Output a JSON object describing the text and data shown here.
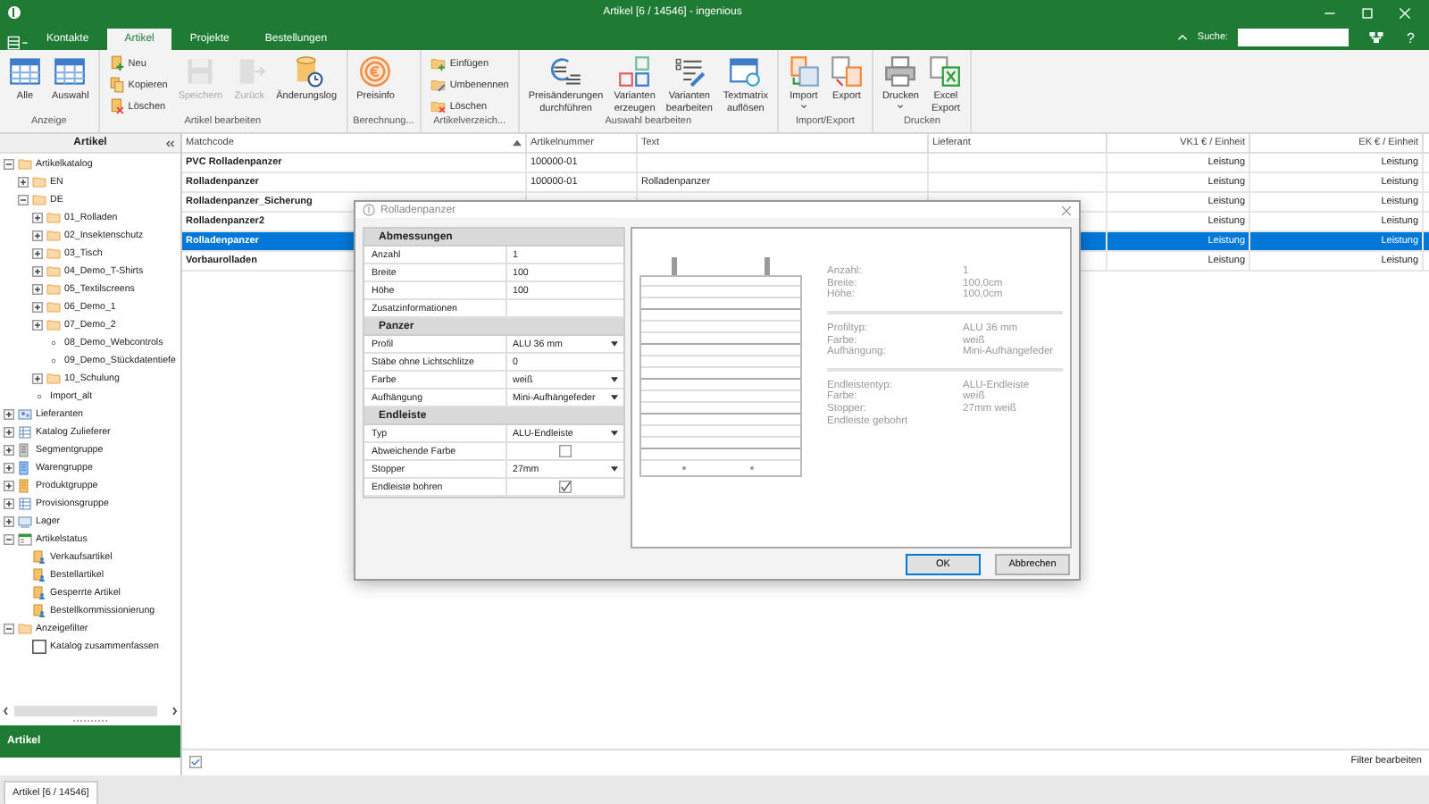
{
  "window": {
    "title": "Artikel [6 / 14546] - ingenious"
  },
  "tabs": [
    {
      "label": "Kontakte",
      "selected": false
    },
    {
      "label": "Artikel",
      "selected": true
    },
    {
      "label": "Projekte",
      "selected": false
    },
    {
      "label": "Bestellungen",
      "selected": false
    }
  ],
  "search": {
    "label": "Suche:",
    "help": "?"
  },
  "ribbon": {
    "groups": [
      {
        "label": "Anzeige",
        "items": [
          {
            "kind": "large",
            "label": "Alle",
            "disabled": false
          },
          {
            "kind": "large",
            "label": "Auswahl",
            "disabled": false
          }
        ]
      },
      {
        "label": "Artikel bearbeiten",
        "items": [
          {
            "kind": "stack",
            "items": [
              {
                "label": "Neu",
                "disabled": false
              },
              {
                "label": "Kopieren",
                "disabled": false
              },
              {
                "label": "Löschen",
                "disabled": false
              }
            ]
          },
          {
            "kind": "large",
            "label": "Speichern",
            "disabled": true
          },
          {
            "kind": "large",
            "label": "Zurück",
            "disabled": true
          },
          {
            "kind": "large",
            "label": "Änderungslog",
            "disabled": false
          }
        ]
      },
      {
        "label": "Berechnung...",
        "items": [
          {
            "kind": "large",
            "label": "Preisinfo",
            "disabled": false
          }
        ]
      },
      {
        "label": "Artikelverzeich...",
        "items": [
          {
            "kind": "stack",
            "items": [
              {
                "label": "Einfügen",
                "disabled": false
              },
              {
                "label": "Umbenennen",
                "disabled": false
              },
              {
                "label": "Löschen",
                "disabled": false
              }
            ]
          }
        ]
      },
      {
        "label": "Auswahl bearbeiten",
        "items": [
          {
            "kind": "large",
            "label": "Preisänderungen durchführen",
            "disabled": false
          },
          {
            "kind": "large",
            "label": "Varianten erzeugen",
            "disabled": false
          },
          {
            "kind": "large",
            "label": "Varianten bearbeiten",
            "disabled": false
          },
          {
            "kind": "large",
            "label": "Textmatrix auflösen",
            "disabled": false
          }
        ]
      },
      {
        "label": "Import/Export",
        "items": [
          {
            "kind": "large",
            "label": "Import",
            "disabled": false,
            "dropdown": true
          },
          {
            "kind": "large",
            "label": "Export",
            "disabled": false,
            "dropdown": false
          }
        ]
      },
      {
        "label": "Drucken",
        "items": [
          {
            "kind": "large",
            "label": "Drucken",
            "disabled": false,
            "dropdown": true
          },
          {
            "kind": "large",
            "label": "Excel Export",
            "disabled": false,
            "dropdown": false
          }
        ]
      }
    ]
  },
  "sidebar": {
    "title": "Artikel",
    "footer": "Artikel",
    "tree": [
      {
        "label": "Artikelkatalog",
        "kind": "folder",
        "expanded": true,
        "children": [
          {
            "label": "EN",
            "kind": "folder",
            "expanded": false
          },
          {
            "label": "DE",
            "kind": "folder",
            "expanded": true,
            "children": [
              {
                "label": "01_Rolladen",
                "kind": "folder",
                "expanded": false
              },
              {
                "label": "02_Insektenschutz",
                "kind": "folder",
                "expanded": false
              },
              {
                "label": "03_Tisch",
                "kind": "folder",
                "expanded": false
              },
              {
                "label": "04_Demo_T-Shirts",
                "kind": "folder",
                "expanded": false
              },
              {
                "label": "05_Textilscreens",
                "kind": "folder",
                "expanded": false
              },
              {
                "label": "06_Demo_1",
                "kind": "folder",
                "expanded": false
              },
              {
                "label": "07_Demo_2",
                "kind": "folder",
                "expanded": false
              },
              {
                "label": "08_Demo_Webcontrols",
                "kind": "leaf"
              },
              {
                "label": "09_Demo_Stückdatentiefe",
                "kind": "leaf"
              },
              {
                "label": "10_Schulung",
                "kind": "folder",
                "expanded": false
              }
            ]
          },
          {
            "label": "Import_alt",
            "kind": "leaf"
          }
        ]
      },
      {
        "label": "Lieferanten",
        "kind": "category",
        "expanded": false
      },
      {
        "label": "Katalog Zulieferer",
        "kind": "category",
        "expanded": false
      },
      {
        "label": "Segmentgruppe",
        "kind": "category",
        "expanded": false
      },
      {
        "label": "Warengruppe",
        "kind": "category",
        "expanded": false
      },
      {
        "label": "Produktgruppe",
        "kind": "category",
        "expanded": false
      },
      {
        "label": "Provisionsgruppe",
        "kind": "category",
        "expanded": false
      },
      {
        "label": "Lager",
        "kind": "category",
        "expanded": false
      },
      {
        "label": "Artikelstatus",
        "kind": "category",
        "expanded": true,
        "children": [
          {
            "label": "Verkaufsartikel",
            "kind": "entry"
          },
          {
            "label": "Bestellartikel",
            "kind": "entry"
          },
          {
            "label": "Gesperrte Artikel",
            "kind": "entry"
          },
          {
            "label": "Bestellkommissionierung",
            "kind": "entry"
          }
        ]
      },
      {
        "label": "Anzeigefilter",
        "kind": "folder",
        "expanded": true,
        "children": [
          {
            "label": "Katalog zusammenfassen",
            "kind": "checkbox",
            "checked": false
          }
        ]
      }
    ]
  },
  "table": {
    "columns": [
      "Matchcode",
      "Artikelnummer",
      "Text",
      "Lieferant",
      "VK1 € / Einheit",
      "EK € / Einheit"
    ],
    "rows": [
      {
        "cells": [
          "PVC Rolladenpanzer",
          "100000-01",
          "",
          "",
          "Leistung",
          "Leistung"
        ],
        "selected": false
      },
      {
        "cells": [
          "Rolladenpanzer",
          "100000-01",
          "Rolladenpanzer",
          "",
          "Leistung",
          "Leistung"
        ],
        "selected": false
      },
      {
        "cells": [
          "Rolladenpanzer_Sicherung",
          "",
          "",
          "",
          "Leistung",
          "Leistung"
        ],
        "selected": false
      },
      {
        "cells": [
          "Rolladenpanzer2",
          "",
          "",
          "",
          "Leistung",
          "Leistung"
        ],
        "selected": false
      },
      {
        "cells": [
          "Rolladenpanzer",
          "",
          "",
          "",
          "Leistung",
          "Leistung"
        ],
        "selected": true
      },
      {
        "cells": [
          "Vorbaurolladen",
          "",
          "",
          "",
          "Leistung",
          "Leistung"
        ],
        "selected": false
      }
    ]
  },
  "footer": {
    "action": "Filter bearbeiten"
  },
  "status_bar": {
    "tab": "Artikel [6 / 14546]"
  },
  "dialog": {
    "title": "Rolladenpanzer",
    "sections": [
      {
        "title": "Abmessungen",
        "rows": [
          {
            "kind": "text",
            "label": "Anzahl",
            "value": "1"
          },
          {
            "kind": "text",
            "label": "Breite",
            "value": "100"
          },
          {
            "kind": "text",
            "label": "Höhe",
            "value": "100"
          },
          {
            "kind": "text",
            "label": "Zusatzinformationen"
          }
        ]
      },
      {
        "title": "Panzer",
        "rows": [
          {
            "kind": "dropdown",
            "label": "Profil",
            "value": "ALU 36 mm"
          },
          {
            "kind": "text",
            "label": "Stäbe ohne Lichtschlitze",
            "value": "0"
          },
          {
            "kind": "dropdown",
            "label": "Farbe",
            "value": "weiß"
          },
          {
            "kind": "dropdown",
            "label": "Aufhängung",
            "value": "Mini-Aufhängefeder"
          }
        ]
      },
      {
        "title": "Endleiste",
        "rows": [
          {
            "kind": "dropdown",
            "label": "Typ",
            "value": "ALU-Endleiste"
          },
          {
            "kind": "checkbox",
            "label": "Abweichende Farbe",
            "checked": false
          },
          {
            "kind": "dropdown",
            "label": "Stopper",
            "value": "27mm"
          },
          {
            "kind": "checkbox",
            "label": "Endleiste bohren",
            "checked": true
          }
        ]
      }
    ],
    "summary": [
      [
        {
          "label": "Anzahl:",
          "value": "1"
        },
        {
          "label": "Breite:",
          "value": "100,0cm"
        },
        {
          "label": "Höhe:",
          "value": "100,0cm"
        }
      ],
      [
        {
          "label": "Profiltyp:",
          "value": "ALU 36 mm"
        },
        {
          "label": "Farbe:",
          "value": "weiß"
        },
        {
          "label": "Aufhängung:",
          "value": "Mini-Aufhängefeder"
        }
      ],
      [
        {
          "label": "Endleistentyp:",
          "value": "ALU-Endleiste"
        },
        {
          "label": "Farbe:",
          "value": "weiß"
        },
        {
          "label": "Stopper:",
          "value": "27mm weiß"
        },
        {
          "label": "Endleiste gebohrt"
        }
      ]
    ],
    "buttons": [
      {
        "label": "OK",
        "default": true
      },
      {
        "label": "Abbrechen",
        "default": false
      }
    ]
  }
}
